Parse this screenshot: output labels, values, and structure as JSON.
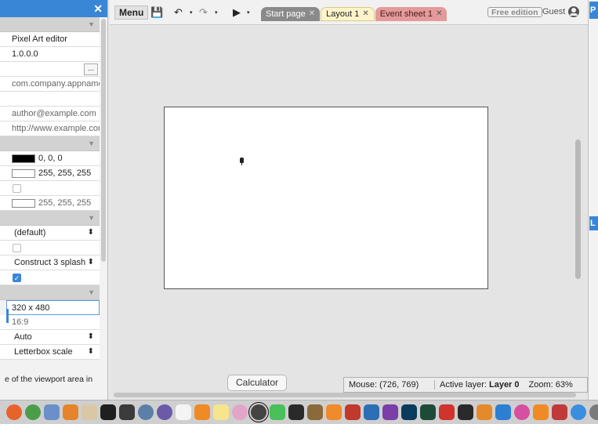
{
  "properties": {
    "close_glyph": "✕",
    "rows": [
      {
        "kind": "section"
      },
      {
        "kind": "text",
        "value": "Pixel Art editor"
      },
      {
        "kind": "text",
        "value": "1.0.0.0"
      },
      {
        "kind": "button",
        "value": "",
        "button_label": "..."
      },
      {
        "kind": "text",
        "value": "com.company.appname",
        "muted": true
      },
      {
        "kind": "text",
        "value": ""
      },
      {
        "kind": "text",
        "value": "author@example.com",
        "muted": true
      },
      {
        "kind": "text",
        "value": "http://www.example.com",
        "muted": true
      },
      {
        "kind": "section"
      },
      {
        "kind": "color",
        "value": "0, 0, 0",
        "swatch": "#000000"
      },
      {
        "kind": "color",
        "value": "255, 255, 255",
        "swatch": "#ffffff"
      },
      {
        "kind": "checkbox",
        "checked": false
      },
      {
        "kind": "color",
        "value": "255, 255, 255",
        "swatch": "#ffffff",
        "muted": true
      },
      {
        "kind": "section"
      },
      {
        "kind": "select",
        "value": "(default)"
      },
      {
        "kind": "checkbox",
        "checked": false
      },
      {
        "kind": "select",
        "value": "Construct 3 splash"
      },
      {
        "kind": "checkbox",
        "checked": true
      },
      {
        "kind": "section"
      },
      {
        "kind": "input",
        "value": "320 x 480"
      },
      {
        "kind": "text",
        "value": "16:9",
        "muted": true
      },
      {
        "kind": "select",
        "value": "Auto"
      },
      {
        "kind": "select",
        "value": "Letterbox scale"
      }
    ],
    "description": "e of the viewport area in"
  },
  "toolbar": {
    "menu_label": "Menu",
    "save_icon": "💾",
    "undo_icon": "↶",
    "redo_icon": "↷",
    "dropdown_icon": "▾",
    "play_icon": "▶",
    "tabs": [
      {
        "label": "Start page",
        "close": "✕"
      },
      {
        "label": "Layout 1",
        "close": "✕"
      },
      {
        "label": "Event sheet 1",
        "close": "✕"
      }
    ],
    "edition_label": "Free edition",
    "user_label": "Guest"
  },
  "right_edge": {
    "top_letter": "P",
    "mid_letter": "L"
  },
  "tooltip": "Calculator",
  "status": {
    "mouse": "Mouse: (726, 769)",
    "layer_label": "Active layer:",
    "layer_value": "Layer 0",
    "zoom": "Zoom: 63%"
  },
  "dock": {
    "icons": [
      {
        "name": "firefox-icon",
        "color": "#e8632b"
      },
      {
        "name": "chrome-icon",
        "color": "#4a9e4a"
      },
      {
        "name": "launchpad-icon",
        "color": "#6b8fc9"
      },
      {
        "name": "sublime-icon",
        "color": "#e5842a"
      },
      {
        "name": "preview-icon",
        "color": "#d9c8a6"
      },
      {
        "name": "pycharm-icon",
        "color": "#1f1f1f"
      },
      {
        "name": "unity-icon",
        "color": "#3b3b3b"
      },
      {
        "name": "network-icon",
        "color": "#5c7fa8"
      },
      {
        "name": "web-icon",
        "color": "#6a5aa8"
      },
      {
        "name": "calendar-icon",
        "color": "#f4f4f4"
      },
      {
        "name": "vlc-icon",
        "color": "#f08a24"
      },
      {
        "name": "notes-icon",
        "color": "#f6e58d"
      },
      {
        "name": "photos-icon",
        "color": "#e2a5c8"
      },
      {
        "name": "calculator-icon",
        "color": "#444444"
      },
      {
        "name": "messages-icon",
        "color": "#49c05a"
      },
      {
        "name": "pycharm-ce-icon",
        "color": "#2a2a2a"
      },
      {
        "name": "tools-icon",
        "color": "#8a6a3a"
      },
      {
        "name": "books-icon",
        "color": "#ef8b2a"
      },
      {
        "name": "pin-icon",
        "color": "#c0392b"
      },
      {
        "name": "affinity-designer-icon",
        "color": "#2c6fb5"
      },
      {
        "name": "affinity-photo-icon",
        "color": "#7a3fa8"
      },
      {
        "name": "photoshop-icon",
        "color": "#0a3a5c"
      },
      {
        "name": "audition-icon",
        "color": "#1e4a3a"
      },
      {
        "name": "heart-icon",
        "color": "#d0342c"
      },
      {
        "name": "piano-icon",
        "color": "#2a2a2a"
      },
      {
        "name": "garageband-icon",
        "color": "#e58a2a"
      },
      {
        "name": "appstore-icon",
        "color": "#2d7fd1"
      },
      {
        "name": "itunes-icon",
        "color": "#d64fa0"
      },
      {
        "name": "vlc2-icon",
        "color": "#f08a24"
      },
      {
        "name": "photo-booth-icon",
        "color": "#c13a3a"
      },
      {
        "name": "app-store-icon",
        "color": "#3a8ee0"
      },
      {
        "name": "system-prefs-icon",
        "color": "#7a7a7a"
      },
      {
        "name": "finder-icon",
        "color": "#4aa0e0"
      }
    ]
  }
}
